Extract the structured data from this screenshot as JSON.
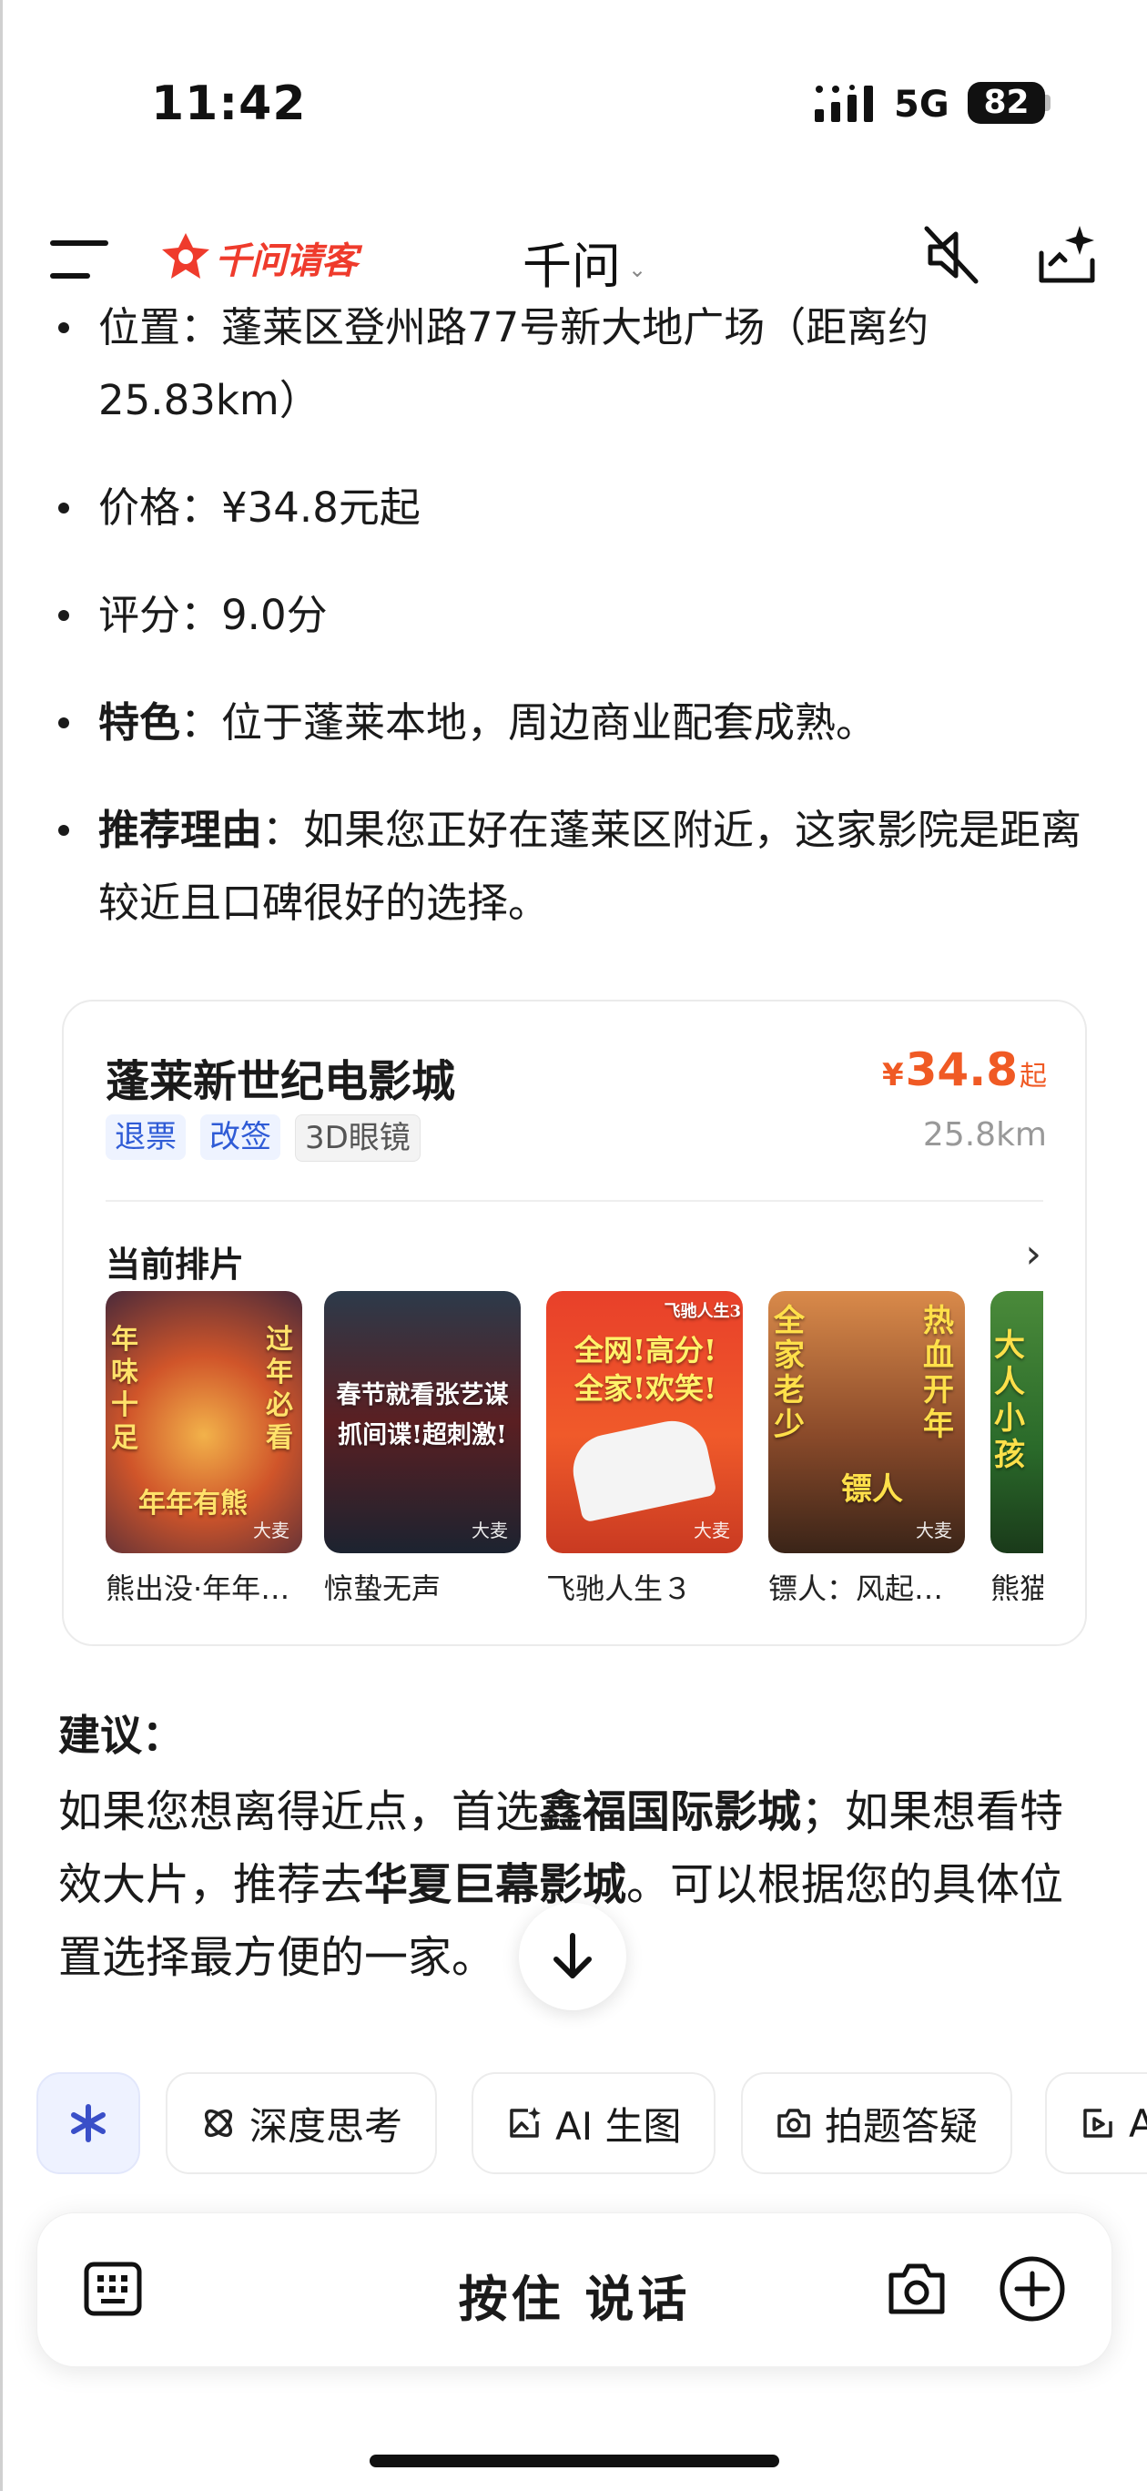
{
  "status_bar": {
    "time": "11:42",
    "network": "5G",
    "battery": "82"
  },
  "header": {
    "logo_text": "千问请客",
    "title": "千问"
  },
  "bullets": [
    {
      "label": "位置",
      "sep": "：",
      "text": "蓬莱区登州路77号新大地广场（距离约25.83km）"
    },
    {
      "label": "价格",
      "sep": "：",
      "text": "¥34.8元起"
    },
    {
      "label": "评分",
      "sep": "：",
      "text": "9.0分"
    },
    {
      "label": "特色",
      "sep": "：",
      "text": "位于蓬莱本地，周边商业配套成熟。"
    },
    {
      "label": "推荐理由",
      "sep": "：",
      "text": "如果您正好在蓬莱区附近，这家影院是距离较近且口碑很好的选择。"
    }
  ],
  "card": {
    "name": "蓬莱新世纪电影城",
    "price_currency": "¥",
    "price": "34.8",
    "price_suffix": "起",
    "distance": "25.8km",
    "tags": [
      "退票",
      "改签",
      "3D眼镜"
    ],
    "section_title": "当前排片",
    "movies": [
      {
        "title": "熊出没·年年有熊",
        "poster_text_a": "年味十足",
        "poster_text_b": "过年必看",
        "poster_text_c": "年年有熊",
        "badge": "大麦"
      },
      {
        "title": "惊蛰无声",
        "poster_text_a": "春节就看张艺谋",
        "poster_text_b": "抓间谍!超刺激!",
        "badge": "大麦"
      },
      {
        "title": "飞驰人生３",
        "poster_text_a": "全网!高分!",
        "poster_text_b": "全家!欢笑!",
        "poster_text_c": "飞驰人生3",
        "badge": "大麦"
      },
      {
        "title": "镖人：风起大漠",
        "poster_text_a": "全家老少",
        "poster_text_b": "热血开年",
        "poster_text_c": "镖人",
        "badge": "大麦"
      },
      {
        "title": "熊猫计划",
        "poster_text_a": "大人小孩",
        "badge": ""
      }
    ]
  },
  "suggestion": {
    "title": "建议：",
    "text_1": "如果您想离得近点，首选",
    "highlight_1": "鑫福国际影城",
    "text_2": "；如果想看特效大片，推荐去",
    "highlight_2": "华夏巨幕影城",
    "text_3": "。可以根据您的具体位置选择最方便的一家。"
  },
  "chips": [
    "深度思考",
    "AI 生图",
    "拍题答疑",
    "A"
  ],
  "input_bar": {
    "talk_label": "按住 说话"
  },
  "colors": {
    "accent": "#f05a24",
    "brand_red": "#ef3b2c",
    "tag_blue": "#2f5bd6"
  }
}
